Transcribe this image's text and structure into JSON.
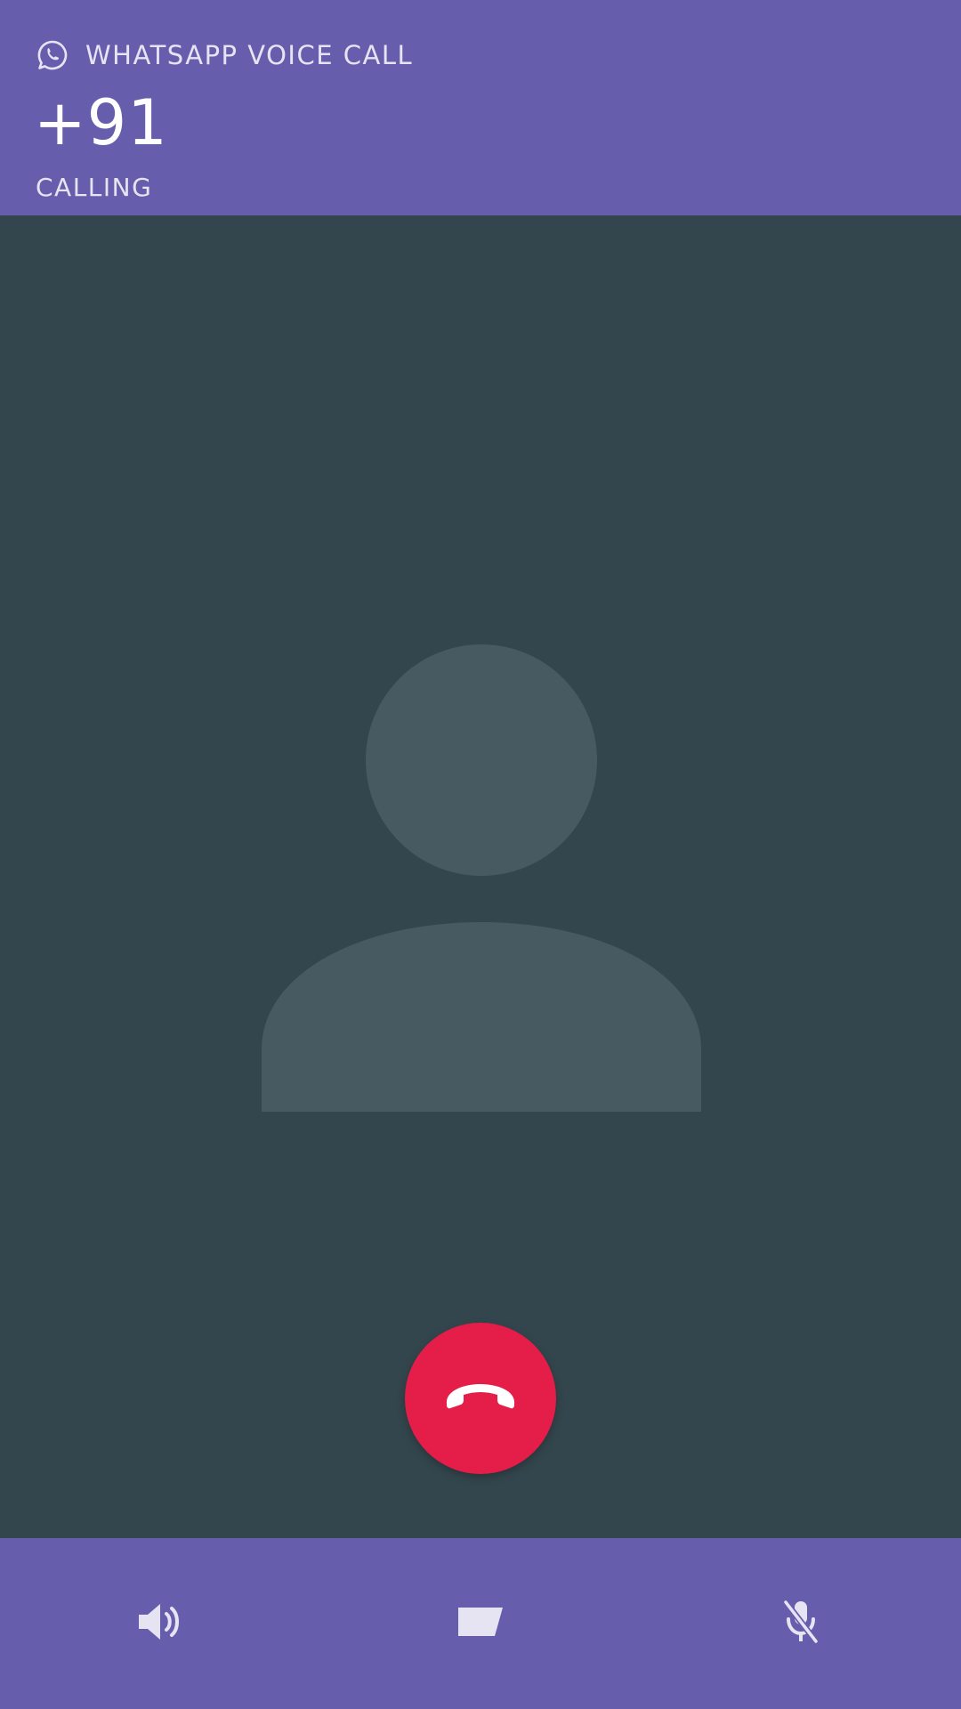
{
  "header": {
    "app_title": "WHATSAPP VOICE CALL",
    "caller_number": "+91",
    "call_status": "CALLING"
  },
  "icons": {
    "app_icon": "whatsapp-icon",
    "avatar": "person-placeholder-icon",
    "end_call": "phone-hangup-icon",
    "speaker": "speaker-icon",
    "video": "video-camera-icon",
    "mute": "microphone-off-icon"
  },
  "colors": {
    "header_bg": "#665eac",
    "body_bg": "#34464d",
    "avatar_fill": "#475a61",
    "end_call": "#e51d49",
    "bottom_bar_bg": "#665eac",
    "icon_light": "#e6e3f3"
  }
}
